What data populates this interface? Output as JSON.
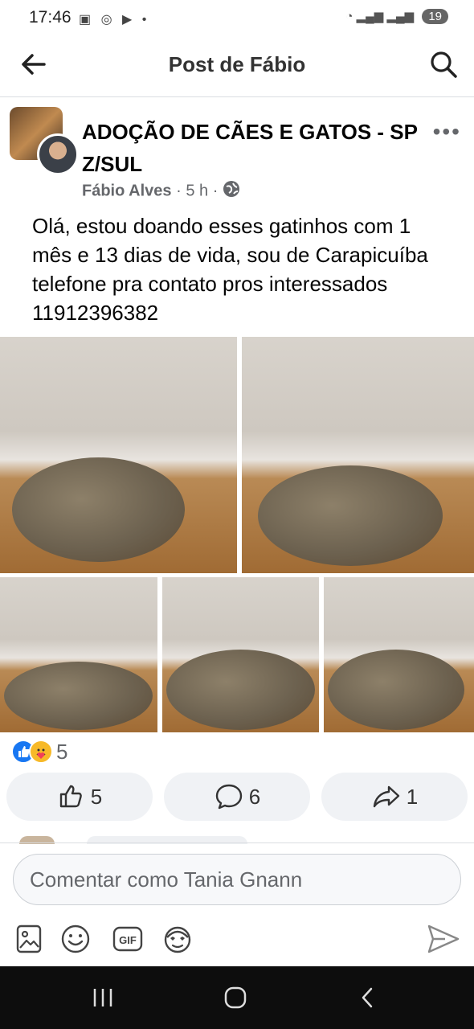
{
  "status_bar": {
    "time": "17:46",
    "icons": [
      "screenshot-icon",
      "chrome-icon",
      "youtube-icon",
      "dot-icon"
    ],
    "right_icons": [
      "wifi-icon",
      "signal-icon",
      "signal-icon"
    ],
    "battery": "19"
  },
  "header": {
    "title": "Post de Fábio"
  },
  "post": {
    "group_name": "ADOÇÃO DE CÃES E GATOS - SP Z/SUL",
    "author": "Fábio Alves",
    "time": "5 h",
    "separator": "·",
    "text": "Olá, estou doando esses gatinhos com 1 mês e 13 dias de vida, sou de Carapicuíba telefone pra contato pros interessados 11912396382",
    "photo_count": 5,
    "reactions": {
      "types": [
        "like",
        "care"
      ],
      "count": "5"
    },
    "actions": [
      {
        "name": "like",
        "count": "5"
      },
      {
        "name": "comment",
        "count": "6"
      },
      {
        "name": "share",
        "count": "1"
      }
    ]
  },
  "comment": {
    "placeholder": "Comentar como Tania Gnann",
    "tools": [
      "photo-icon",
      "emoji-icon",
      "gif-icon",
      "avatar-sticker-icon"
    ]
  },
  "colors": {
    "accent": "#1877f2",
    "pill_bg": "#f0f2f5",
    "secondary_text": "#65676b",
    "nav_bg": "#0d0d0d"
  }
}
